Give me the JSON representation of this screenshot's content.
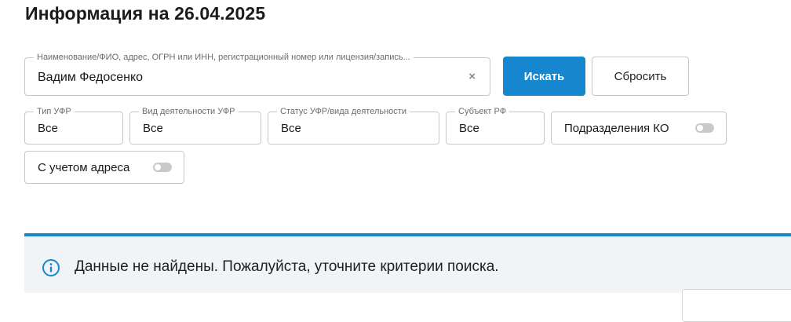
{
  "page": {
    "title": "Информация на 26.04.2025"
  },
  "search": {
    "label": "Наименование/ФИО, адрес, ОГРН или ИНН, регистрационный номер или лицензия/запись...",
    "value": "Вадим Федосенко",
    "clear_glyph": "×",
    "search_button": "Искать",
    "reset_button": "Сбросить"
  },
  "filters": {
    "ufr_type": {
      "label": "Тип УФР",
      "value": "Все"
    },
    "activity_type": {
      "label": "Вид деятельности УФР",
      "value": "Все"
    },
    "status": {
      "label": "Статус УФР/вида деятельности",
      "value": "Все"
    },
    "region": {
      "label": "Субъект РФ",
      "value": "Все"
    },
    "ko_divisions": {
      "label": "Подразделения КО",
      "enabled": false
    },
    "with_address": {
      "label": "С учетом адреса",
      "enabled": false
    }
  },
  "result": {
    "icon": "info-icon",
    "message": "Данные не найдены. Пожалуйста, уточните критерии поиска."
  },
  "colors": {
    "accent": "#1687cf",
    "result_bg": "#f1f4f6",
    "border": "#c7c7c7"
  }
}
